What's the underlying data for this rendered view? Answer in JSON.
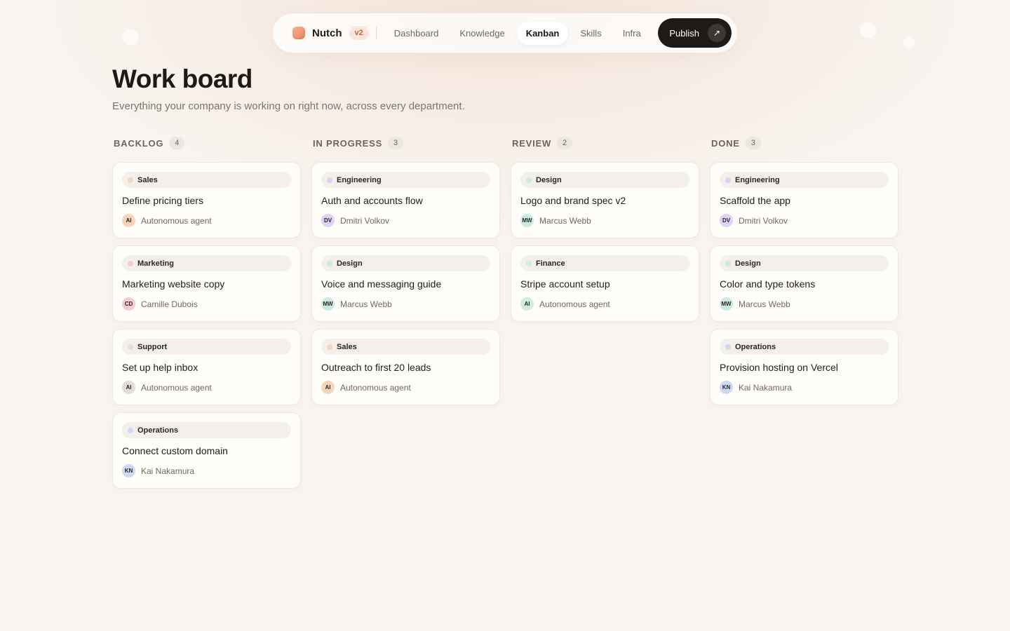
{
  "nav": {
    "brand": "Nutch",
    "version": "v2",
    "links": [
      "Dashboard",
      "Knowledge",
      "Kanban",
      "Skills",
      "Infra"
    ],
    "active": "Kanban",
    "publish_label": "Publish",
    "publish_icon": "arrow-up-right-icon"
  },
  "header": {
    "title": "Work board",
    "subtitle": "Everything your company is working on right now, across every department."
  },
  "colors": {
    "sales": "#f6d5b8",
    "marketing": "#f6c9d6",
    "support": "#e2ddd8",
    "operations": "#cdd9f5",
    "engineering": "#dcd2f5",
    "design": "#cde9e3",
    "finance": "#d3ecda"
  },
  "columns": [
    {
      "title": "BACKLOG",
      "count": "4",
      "cards": [
        {
          "dept": "Sales",
          "title": "Define pricing tiers",
          "initials": "AI",
          "assignee": "Autonomous agent"
        },
        {
          "dept": "Marketing",
          "title": "Marketing website copy",
          "initials": "CD",
          "assignee": "Camille Dubois"
        },
        {
          "dept": "Support",
          "title": "Set up help inbox",
          "initials": "AI",
          "assignee": "Autonomous agent"
        },
        {
          "dept": "Operations",
          "title": "Connect custom domain",
          "initials": "KN",
          "assignee": "Kai Nakamura"
        }
      ]
    },
    {
      "title": "IN PROGRESS",
      "count": "3",
      "cards": [
        {
          "dept": "Engineering",
          "title": "Auth and accounts flow",
          "initials": "DV",
          "assignee": "Dmitri Volkov"
        },
        {
          "dept": "Design",
          "title": "Voice and messaging guide",
          "initials": "MW",
          "assignee": "Marcus Webb"
        },
        {
          "dept": "Sales",
          "title": "Outreach to first 20 leads",
          "initials": "AI",
          "assignee": "Autonomous agent"
        }
      ]
    },
    {
      "title": "REVIEW",
      "count": "2",
      "cards": [
        {
          "dept": "Design",
          "title": "Logo and brand spec v2",
          "initials": "MW",
          "assignee": "Marcus Webb"
        },
        {
          "dept": "Finance",
          "title": "Stripe account setup",
          "initials": "AI",
          "assignee": "Autonomous agent"
        }
      ]
    },
    {
      "title": "DONE",
      "count": "3",
      "cards": [
        {
          "dept": "Engineering",
          "title": "Scaffold the app",
          "initials": "DV",
          "assignee": "Dmitri Volkov"
        },
        {
          "dept": "Design",
          "title": "Color and type tokens",
          "initials": "MW",
          "assignee": "Marcus Webb"
        },
        {
          "dept": "Operations",
          "title": "Provision hosting on Vercel",
          "initials": "KN",
          "assignee": "Kai Nakamura"
        }
      ]
    }
  ]
}
